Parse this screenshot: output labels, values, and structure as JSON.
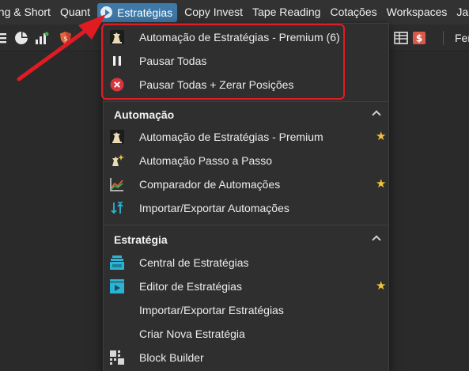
{
  "menubar": {
    "items": [
      {
        "label": "ong & Short"
      },
      {
        "label": "Quant"
      },
      {
        "label": "Estratégias"
      },
      {
        "label": "Copy Invest"
      },
      {
        "label": "Tape Reading"
      },
      {
        "label": "Cotações"
      },
      {
        "label": "Workspaces"
      },
      {
        "label": "Jane"
      }
    ]
  },
  "toolbar": {
    "right_text": "Fer"
  },
  "dropdown": {
    "quick_actions": [
      {
        "label": "Automação de Estratégias - Premium (6)",
        "icon": "chess-pieces-icon"
      },
      {
        "label": "Pausar Todas",
        "icon": "pause-icon"
      },
      {
        "label": "Pausar Todas + Zerar Posições",
        "icon": "close-circle-icon"
      }
    ],
    "sections": [
      {
        "title": "Automação",
        "items": [
          {
            "label": "Automação de Estratégias - Premium",
            "icon": "chess-pieces-icon",
            "favorite": true
          },
          {
            "label": "Automação Passo a Passo",
            "icon": "chess-pieces-sparkle-icon",
            "favorite": false
          },
          {
            "label": "Comparador de Automações",
            "icon": "line-chart-icon",
            "favorite": true
          },
          {
            "label": "Importar/Exportar Automações",
            "icon": "import-export-icon",
            "favorite": false
          }
        ]
      },
      {
        "title": "Estratégia",
        "items": [
          {
            "label": "Central de Estratégias",
            "icon": "strategy-hub-icon",
            "favorite": false
          },
          {
            "label": "Editor de Estratégias",
            "icon": "strategy-editor-icon",
            "favorite": true
          },
          {
            "label": "Importar/Exportar Estratégias",
            "icon": "",
            "favorite": false
          },
          {
            "label": "Criar Nova Estratégia",
            "icon": "",
            "favorite": false
          },
          {
            "label": "Block Builder",
            "icon": "blocks-icon",
            "favorite": false
          }
        ]
      }
    ]
  },
  "colors": {
    "accent": "#3e79a8",
    "star": "#f2c23a",
    "annotation": "#e21b23",
    "danger": "#d9363e",
    "cyan": "#2bb3d4"
  }
}
